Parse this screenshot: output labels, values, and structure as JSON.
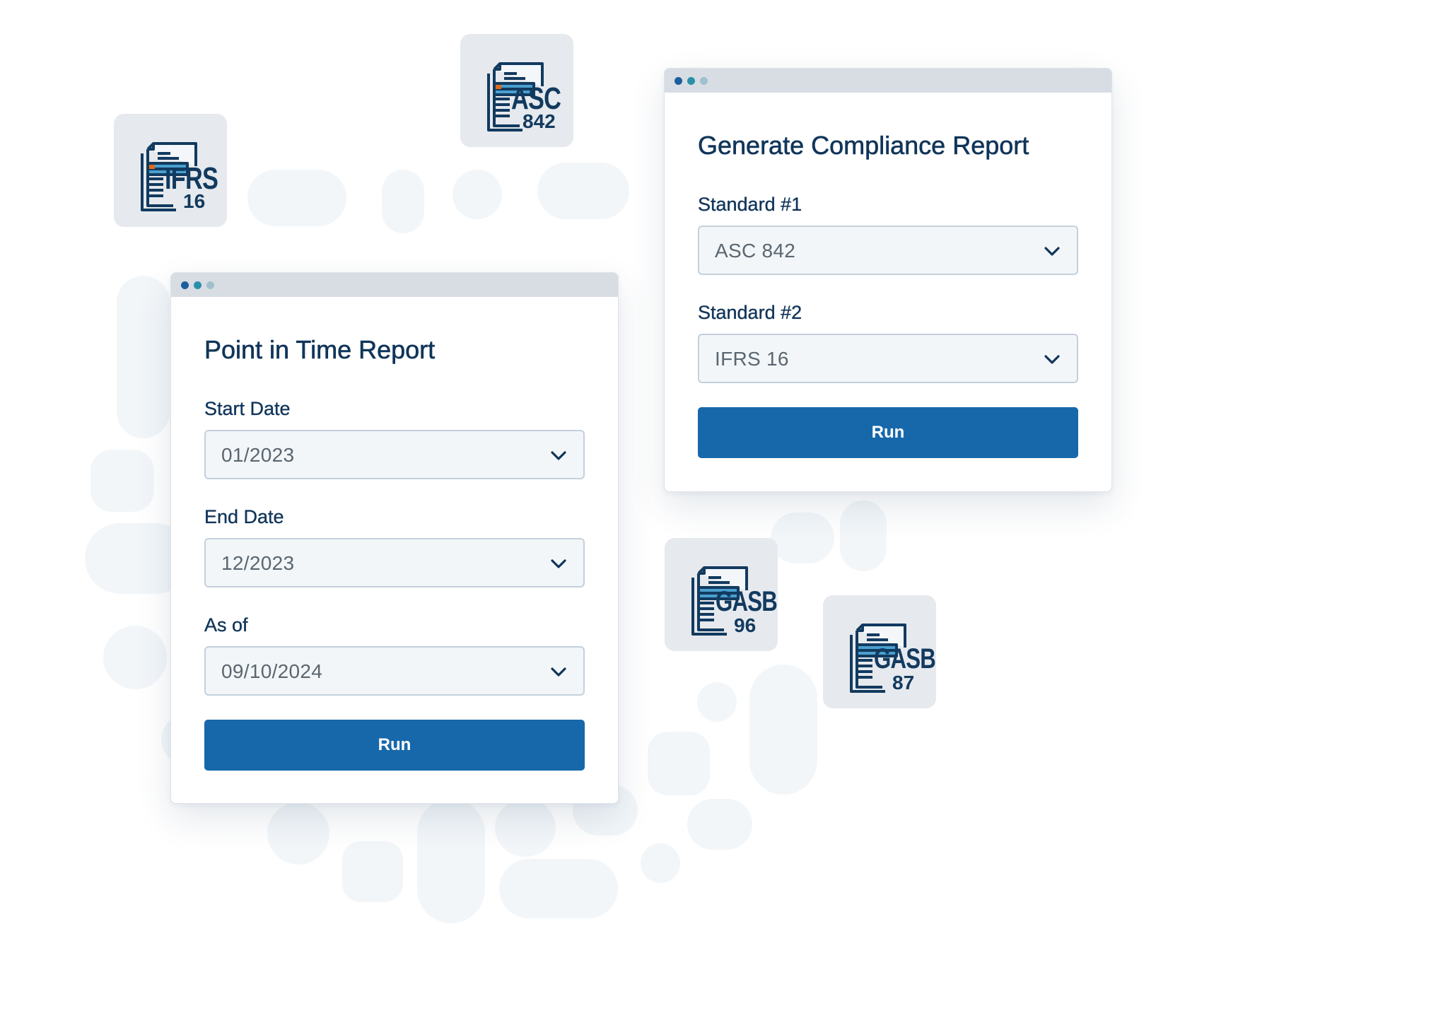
{
  "point_in_time_report": {
    "title": "Point in Time Report",
    "start_date": {
      "label": "Start Date",
      "value": "01/2023"
    },
    "end_date": {
      "label": "End Date",
      "value": "12/2023"
    },
    "as_of": {
      "label": "As of",
      "value": "09/10/2024"
    },
    "run_label": "Run"
  },
  "compliance_report": {
    "title": "Generate Compliance Report",
    "standard_1": {
      "label": "Standard #1",
      "value": "ASC 842"
    },
    "standard_2": {
      "label": "Standard #2",
      "value": "IFRS 16"
    },
    "run_label": "Run"
  },
  "document_icons": {
    "ifrs_16": {
      "code": "IFRS",
      "number": "16"
    },
    "asc_842": {
      "code": "ASC",
      "number": "842"
    },
    "gasb_96": {
      "code": "GASB",
      "number": "96"
    },
    "gasb_87": {
      "code": "GASB",
      "number": "87"
    }
  },
  "colors": {
    "accent": "#1768aa",
    "title_text": "#11355a",
    "titlebar": "#d7dde3",
    "tile_bg": "#e6e9ed"
  }
}
